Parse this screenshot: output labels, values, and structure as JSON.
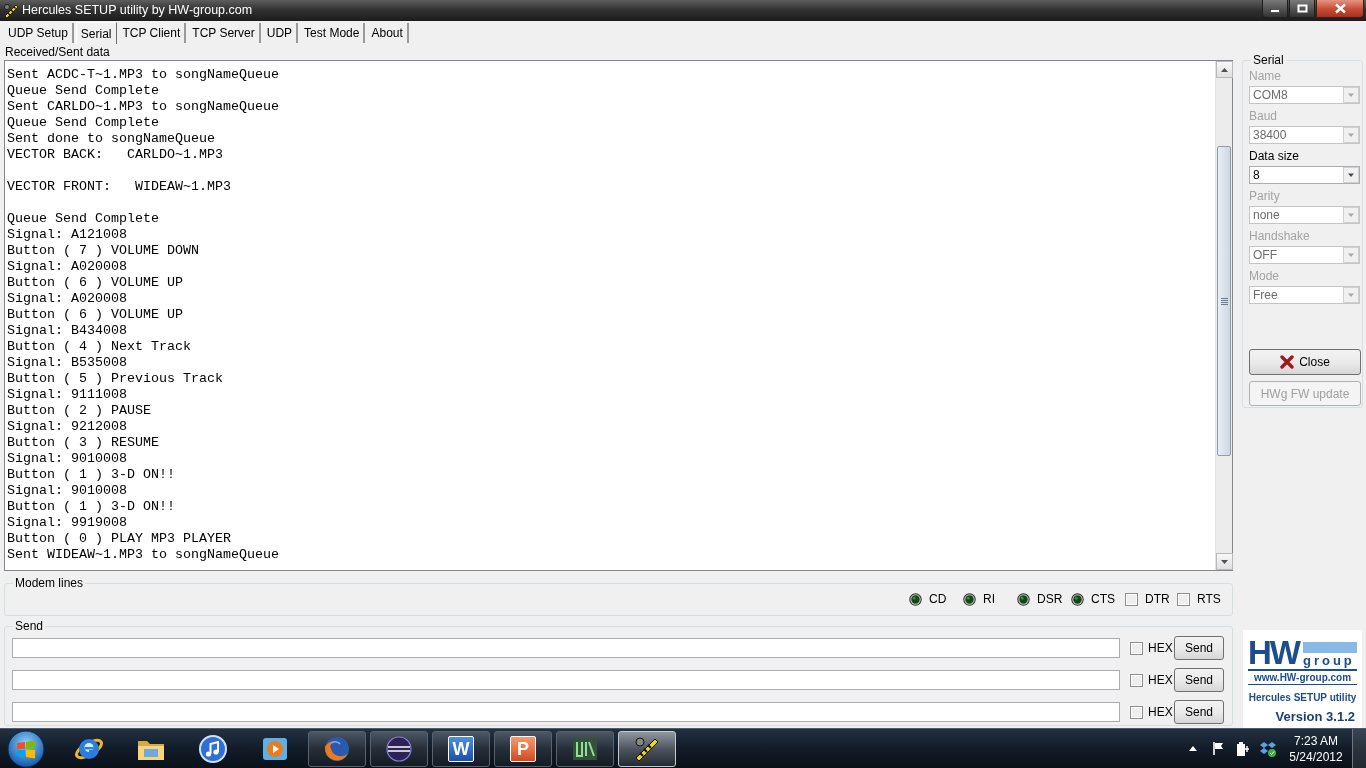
{
  "window": {
    "title": "Hercules SETUP utility by HW-group.com"
  },
  "tabs": [
    {
      "label": "UDP Setup",
      "selected": false
    },
    {
      "label": "Serial",
      "selected": true
    },
    {
      "label": "TCP Client",
      "selected": false
    },
    {
      "label": "TCP Server",
      "selected": false
    },
    {
      "label": "UDP",
      "selected": false
    },
    {
      "label": "Test Mode",
      "selected": false
    },
    {
      "label": "About",
      "selected": false
    }
  ],
  "received_data": {
    "label": "Received/Sent data",
    "blocks": [
      [
        "Sent ACDC-T~1.MP3 to songNameQueue",
        "Queue Send Complete",
        "Sent CARLDO~1.MP3 to songNameQueue",
        "Queue Send Complete",
        "Sent done to songNameQueue",
        "VECTOR BACK:   CARLDO~1.MP3"
      ],
      [
        "VECTOR FRONT:   WIDEAW~1.MP3"
      ],
      [
        "Queue Send Complete",
        "Signal: A121008",
        "Button ( 7 ) VOLUME DOWN",
        "Signal: A020008",
        "Button ( 6 ) VOLUME UP",
        "Signal: A020008",
        "Button ( 6 ) VOLUME UP",
        "Signal: B434008",
        "Button ( 4 ) Next Track",
        "Signal: B535008",
        "Button ( 5 ) Previous Track",
        "Signal: 9111008",
        "Button ( 2 ) PAUSE",
        "Signal: 9212008",
        "Button ( 3 ) RESUME",
        "Signal: 9010008",
        "Button ( 1 ) 3-D ON!!",
        "Signal: 9010008",
        "Button ( 1 ) 3-D ON!!",
        "Signal: 9919008",
        "Button ( 0 ) PLAY MP3 PLAYER",
        "Sent WIDEAW~1.MP3 to songNameQueue"
      ]
    ]
  },
  "modem_lines": {
    "title": "Modem lines",
    "signals": [
      {
        "kind": "led",
        "label": "CD",
        "on": false
      },
      {
        "kind": "led",
        "label": "RI",
        "on": false
      },
      {
        "kind": "led",
        "label": "DSR",
        "on": false
      },
      {
        "kind": "led",
        "label": "CTS",
        "on": false
      },
      {
        "kind": "checkbox",
        "label": "DTR",
        "checked": false
      },
      {
        "kind": "checkbox",
        "label": "RTS",
        "checked": false
      }
    ]
  },
  "send": {
    "title": "Send",
    "rows": [
      {
        "hex_label": "HEX",
        "hex_checked": false,
        "button": "Send"
      },
      {
        "hex_label": "HEX",
        "hex_checked": false,
        "button": "Send"
      },
      {
        "hex_label": "HEX",
        "hex_checked": false,
        "button": "Send"
      }
    ]
  },
  "serial": {
    "title": "Serial",
    "settings": [
      {
        "label": "Name",
        "value": "COM8",
        "disabled": true
      },
      {
        "label": "Baud",
        "value": "38400",
        "disabled": true
      },
      {
        "label": "Data size",
        "value": "8",
        "disabled": false
      },
      {
        "label": "Parity",
        "value": "none",
        "disabled": true
      },
      {
        "label": "Handshake",
        "value": "OFF",
        "disabled": true
      },
      {
        "label": "Mode",
        "value": "Free",
        "disabled": true
      }
    ],
    "buttons": [
      {
        "kind": "close",
        "label": "Close",
        "disabled": false
      },
      {
        "kind": "plain",
        "label": "HWg FW update",
        "disabled": true
      }
    ]
  },
  "logo": {
    "mark": "HW",
    "mark_suffix": "group",
    "url": "www.HW-group.com",
    "product": "Hercules SETUP utility",
    "version": "Version 3.1.2"
  },
  "taskbar": {
    "apps": [
      {
        "kind": "ebrowser",
        "running": false,
        "active": false
      },
      {
        "kind": "folder",
        "running": false,
        "active": false
      },
      {
        "kind": "music",
        "running": false,
        "active": false
      },
      {
        "kind": "player",
        "running": false,
        "active": false
      },
      {
        "kind": "foxbrowser",
        "running": true,
        "active": false
      },
      {
        "kind": "sphere",
        "running": true,
        "active": false
      },
      {
        "kind": "document",
        "running": true,
        "active": false,
        "glyph": "W"
      },
      {
        "kind": "slides",
        "running": true,
        "active": false,
        "glyph": "P"
      },
      {
        "kind": "chart",
        "running": true,
        "active": false
      },
      {
        "kind": "tool",
        "running": true,
        "active": true
      }
    ],
    "clock": {
      "time": "7:23 AM",
      "date": "5/24/2012"
    }
  }
}
